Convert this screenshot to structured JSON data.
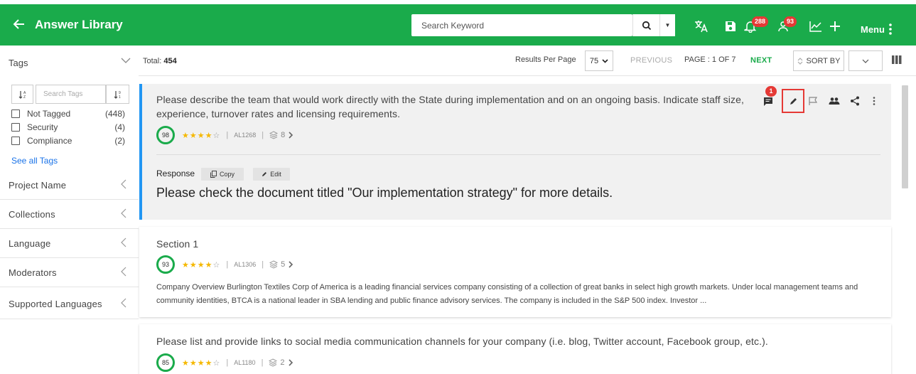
{
  "header": {
    "title": "Answer Library",
    "search_placeholder": "Search Keyword",
    "notifications_count": "288",
    "user_count": "93",
    "menu_label": "Menu"
  },
  "sidebar": {
    "tags_title": "Tags",
    "tag_search_placeholder": "Search Tags",
    "tags": [
      {
        "label": "Not Tagged",
        "count": "(448)"
      },
      {
        "label": "Security",
        "count": "(4)"
      },
      {
        "label": "Compliance",
        "count": "(2)"
      }
    ],
    "see_all": "See all Tags",
    "filters": [
      "Project Name",
      "Collections",
      "Language",
      "Moderators",
      "Supported Languages"
    ]
  },
  "toolbar": {
    "total_label": "Total:",
    "total_value": "454",
    "rpp_label": "Results Per Page",
    "rpp_value": "75",
    "prev": "PREVIOUS",
    "page": "PAGE : 1 OF 7",
    "next": "NEXT",
    "sort_by": "SORT BY"
  },
  "cards": [
    {
      "question": "Please describe the team that would work directly with the State during implementation and on an ongoing basis. Indicate staff size, experience, turnover rates and licensing requirements.",
      "score": "98",
      "stars": 4,
      "id": "AL1268",
      "versions": "8",
      "comment_count": "1",
      "response_label": "Response",
      "copy_label": "Copy",
      "edit_label": "Edit",
      "response": "Please check the document titled \"Our implementation strategy\" for more details."
    },
    {
      "question": "Section 1",
      "score": "93",
      "stars": 4,
      "id": "AL1306",
      "versions": "5",
      "body": "Company Overview Burlington Textiles Corp of America is a leading financial services company consisting of a collection of great banks in select high growth markets. Under local management teams and community identities, BTCA is a national leader in SBA lending and public finance advisory services. The company is included in the S&P 500 index. Investor ..."
    },
    {
      "question": "Please list and provide links to social media communication channels for your company (i.e. blog, Twitter account, Facebook group, etc.).",
      "score": "85",
      "stars": 4,
      "id": "AL1180",
      "versions": "2"
    }
  ],
  "colors": {
    "brand": "#1aab4b",
    "badge": "#e53935",
    "selected_bar": "#2196f3",
    "star": "#f5b800"
  }
}
